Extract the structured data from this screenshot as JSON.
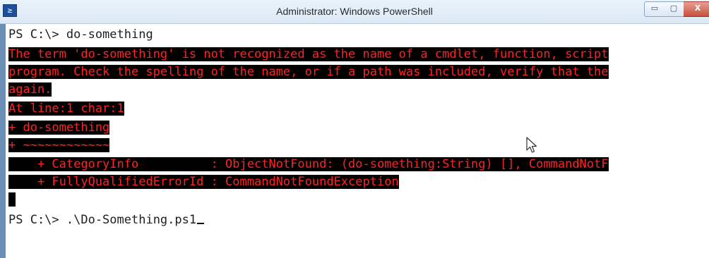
{
  "window": {
    "title": "Administrator: Windows PowerShell",
    "icon": "powershell-icon",
    "icon_glyph": "≥",
    "controls": {
      "minimize": "▭",
      "maximize": "▢",
      "close": "X"
    }
  },
  "console": {
    "prompt_line": "PS C:\\> do-something",
    "error_lines": [
      "The term 'do-something' is not recognized as the name of a cmdlet, function, script",
      "program. Check the spelling of the name, or if a path was included, verify that the",
      "again.",
      "At line:1 char:1",
      "+ do-something",
      "+ ~~~~~~~~~~~~",
      "    + CategoryInfo          : ObjectNotFound: (do-something:String) [], CommandNotF",
      "    + FullyQualifiedErrorId : CommandNotFoundException",
      " "
    ],
    "current_prompt": "PS C:\\> .\\Do-Something.ps1"
  },
  "colors": {
    "error_text": "#ff2222",
    "error_background": "#000000",
    "console_background": "#ffffff"
  }
}
